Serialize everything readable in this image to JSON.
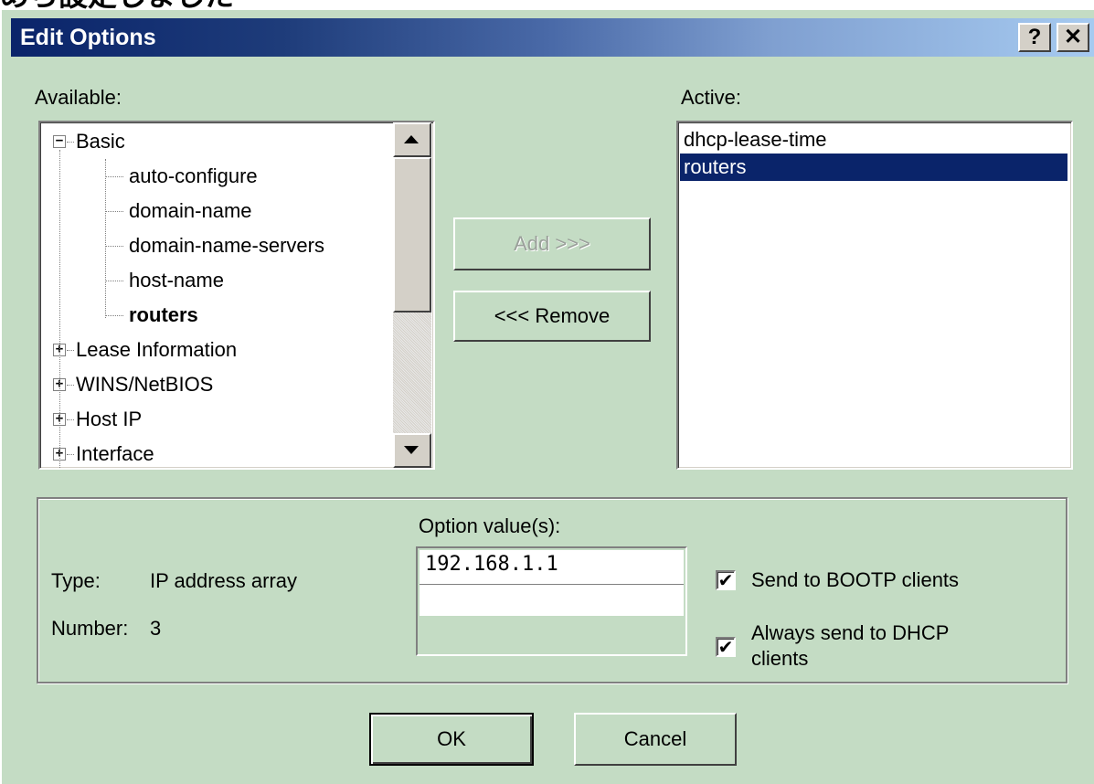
{
  "top_caption": "めら設定しました",
  "dialog": {
    "title": "Edit Options",
    "help_label": "?",
    "close_label": "✕"
  },
  "available": {
    "label": "Available:",
    "tree": [
      {
        "label": "Basic",
        "level": 0,
        "expander": "−"
      },
      {
        "label": "auto-configure",
        "level": 1
      },
      {
        "label": "domain-name",
        "level": 1
      },
      {
        "label": "domain-name-servers",
        "level": 1
      },
      {
        "label": "host-name",
        "level": 1
      },
      {
        "label": "routers",
        "level": 1,
        "bold": true
      },
      {
        "label": "Lease Information",
        "level": 0,
        "expander": "+"
      },
      {
        "label": "WINS/NetBIOS",
        "level": 0,
        "expander": "+"
      },
      {
        "label": "Host IP",
        "level": 0,
        "expander": "+"
      },
      {
        "label": "Interface",
        "level": 0,
        "expander": "+"
      }
    ]
  },
  "buttons": {
    "add": "Add >>>",
    "remove": "<<< Remove",
    "ok": "OK",
    "cancel": "Cancel"
  },
  "active": {
    "label": "Active:",
    "items": [
      "dhcp-lease-time",
      "routers"
    ],
    "selected_index": 1
  },
  "details": {
    "type_label": "Type:",
    "type_value": "IP address array",
    "number_label": "Number:",
    "number_value": "3",
    "option_values_label": "Option value(s):",
    "option_values": [
      "192.168.1.1",
      ""
    ],
    "send_bootp_label": "Send to BOOTP clients",
    "send_bootp_checked": true,
    "always_send_label_line1": "Always send to DHCP",
    "always_send_label_line2": "clients",
    "always_send_checked": true
  }
}
